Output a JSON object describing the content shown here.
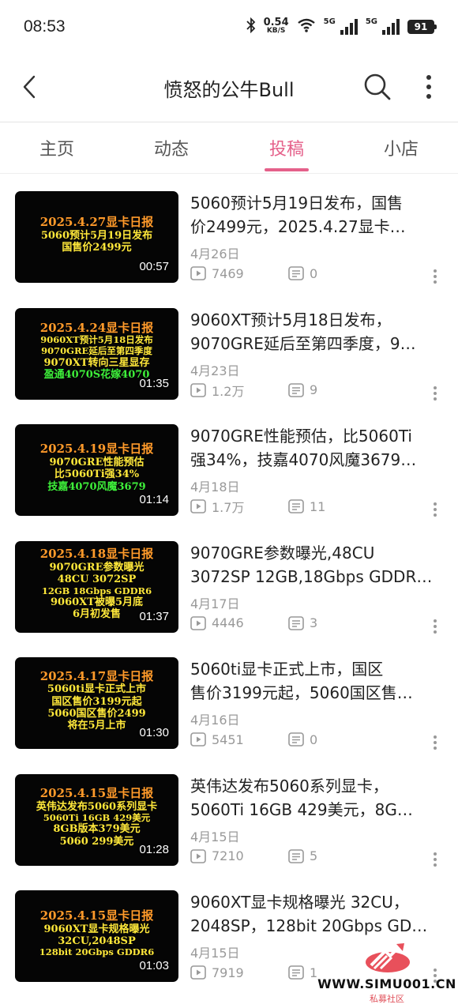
{
  "status_bar": {
    "time": "08:53",
    "speed_value": "0.54",
    "speed_unit": "KB/S",
    "network_1": "5G",
    "network_2": "5G",
    "battery": "91",
    "icons": [
      "bluetooth-icon",
      "wifi-icon",
      "signal-icon",
      "signal-icon",
      "battery-icon"
    ]
  },
  "header": {
    "title": "愤怒的公牛Bull",
    "back_icon": "chevron-left-icon",
    "search_icon": "search-icon",
    "more_icon": "more-vertical-icon"
  },
  "tabs": [
    {
      "label": "主页",
      "active": false
    },
    {
      "label": "动态",
      "active": false
    },
    {
      "label": "投稿",
      "active": true
    },
    {
      "label": "小店",
      "active": false
    }
  ],
  "accent_color": "#e5608a",
  "videos": [
    {
      "thumb_lines": [
        "2025.4.27显卡日报",
        "5060预计5月19日发布",
        "国售价2499元"
      ],
      "duration": "00:57",
      "title_line1": "5060预计5月19日发布，国售",
      "title_line2": "价2499元，2025.4.27显卡…",
      "date": "4月26日",
      "plays": "7469",
      "comments": "0"
    },
    {
      "thumb_lines": [
        "2025.4.24显卡日报",
        "9060XT预计5月18日发布",
        "9070GRE延后至第四季度",
        "9070XT转向三星显存",
        "盈通4070S花嫁4070"
      ],
      "duration": "01:35",
      "title_line1": "9060XT预计5月18日发布，",
      "title_line2": "9070GRE延后至第四季度，9…",
      "date": "4月23日",
      "plays": "1.2万",
      "comments": "9"
    },
    {
      "thumb_lines": [
        "2025.4.19显卡日报",
        "9070GRE性能预估",
        "比5060Ti强34%",
        "技嘉4070风魔3679"
      ],
      "duration": "01:14",
      "title_line1": "9070GRE性能预估，比5060Ti",
      "title_line2": "强34%，技嘉4070风魔3679…",
      "date": "4月18日",
      "plays": "1.7万",
      "comments": "11"
    },
    {
      "thumb_lines": [
        "2025.4.18显卡日报",
        "9070GRE参数曝光",
        "48CU 3072SP",
        "12GB 18Gbps GDDR6",
        "9060XT被曝5月底",
        "6月初发售"
      ],
      "duration": "01:37",
      "title_line1": "9070GRE参数曝光,48CU",
      "title_line2": "3072SP 12GB,18Gbps GDDR…",
      "date": "4月17日",
      "plays": "4446",
      "comments": "3"
    },
    {
      "thumb_lines": [
        "2025.4.17显卡日报",
        "5060ti显卡正式上市",
        "国区售价3199元起",
        "5060国区售价2499",
        "将在5月上市"
      ],
      "duration": "01:30",
      "title_line1": "5060ti显卡正式上市，国区",
      "title_line2": "售价3199元起，5060国区售…",
      "date": "4月16日",
      "plays": "5451",
      "comments": "0"
    },
    {
      "thumb_lines": [
        "2025.4.15显卡日报",
        "英伟达发布5060系列显卡",
        "5060Ti 16GB 429美元",
        "8GB版本379美元",
        "5060 299美元"
      ],
      "duration": "01:28",
      "title_line1": "英伟达发布5060系列显卡，",
      "title_line2": "5060Ti 16GB 429美元，8G…",
      "date": "4月15日",
      "plays": "7210",
      "comments": "5"
    },
    {
      "thumb_lines": [
        "2025.4.15显卡日报",
        "9060XT显卡规格曝光",
        "32CU,2048SP",
        "128bit 20Gbps GDDR6"
      ],
      "duration": "01:03",
      "title_line1": "9060XT显卡规格曝光 32CU，",
      "title_line2": "2048SP，128bit 20Gbps GD…",
      "date": "4月15日",
      "plays": "7919",
      "comments": "1"
    }
  ],
  "watermark": {
    "url": "WWW.SIMU001.CN",
    "sub": "私募社区"
  }
}
